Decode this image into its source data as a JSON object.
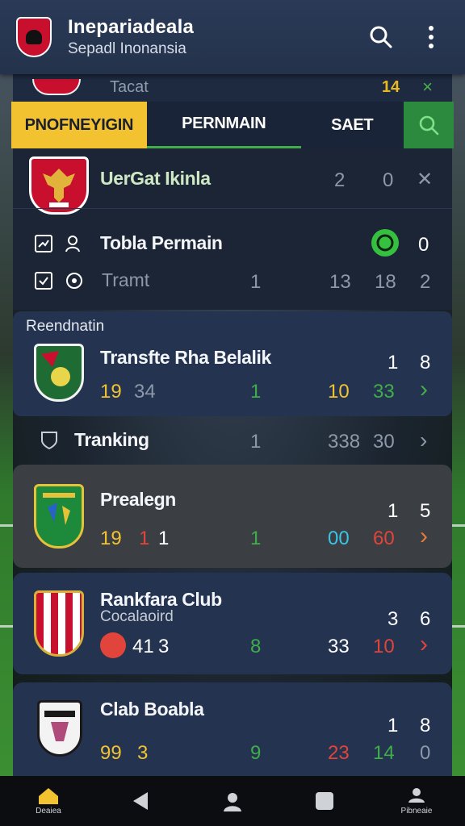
{
  "app": {
    "title": "Inepariadeala",
    "subtitle": "Sepadl Inonansia"
  },
  "peek": {
    "label": "Tacat",
    "value": "14",
    "close": "×"
  },
  "tabs": [
    {
      "label": "PNOFNEYIGIN"
    },
    {
      "label": "PERNMAIN"
    },
    {
      "label": "SAET"
    }
  ],
  "header_row": {
    "title": "UerGat Ikinla",
    "v1": "2",
    "v2": "0",
    "close": "✕"
  },
  "stats": {
    "title": "Tobla Permain",
    "score": "0",
    "row_label": "Tramt",
    "r1": "1",
    "r2": "13",
    "r3": "18",
    "r4": "2"
  },
  "section_label": "Reendnatin",
  "items": [
    {
      "title": "Transfte Rha Belalik",
      "top1": "1",
      "top2": "8",
      "a": "19",
      "b": "34",
      "c": "1",
      "d": "10",
      "e": "33",
      "arrow": "›"
    },
    {
      "title": "Tranking",
      "c": "1",
      "d": "338",
      "e": "30",
      "arrow": "›"
    },
    {
      "title": "Prealegn",
      "top1": "1",
      "top2": "5",
      "a": "19",
      "b": "1",
      "b2": "1",
      "c": "1",
      "d": "00",
      "e": "60",
      "arrow": "›"
    },
    {
      "title": "Rankfara Club",
      "subtitle": "Cocalaoird",
      "top1": "3",
      "top2": "6",
      "a": "41",
      "b": "3",
      "c": "8",
      "d": "33",
      "e": "10",
      "arrow": "›"
    },
    {
      "title": "Clab Boabla",
      "top1": "1",
      "top2": "8",
      "a": "99",
      "b": "3",
      "c": "9",
      "d": "23",
      "e": "14",
      "f": "0"
    }
  ],
  "nav": [
    {
      "label": "Deaiea",
      "icon": "home-icon"
    },
    {
      "label": "",
      "icon": "back-icon"
    },
    {
      "label": "",
      "icon": "person-icon"
    },
    {
      "label": "",
      "icon": "square-icon"
    },
    {
      "label": "Pibneaie",
      "icon": "profile-icon"
    }
  ],
  "colors": {
    "accent_yellow": "#f2c230",
    "accent_green": "#3fae49",
    "red": "#e0443a",
    "cyan": "#37c6e6"
  }
}
